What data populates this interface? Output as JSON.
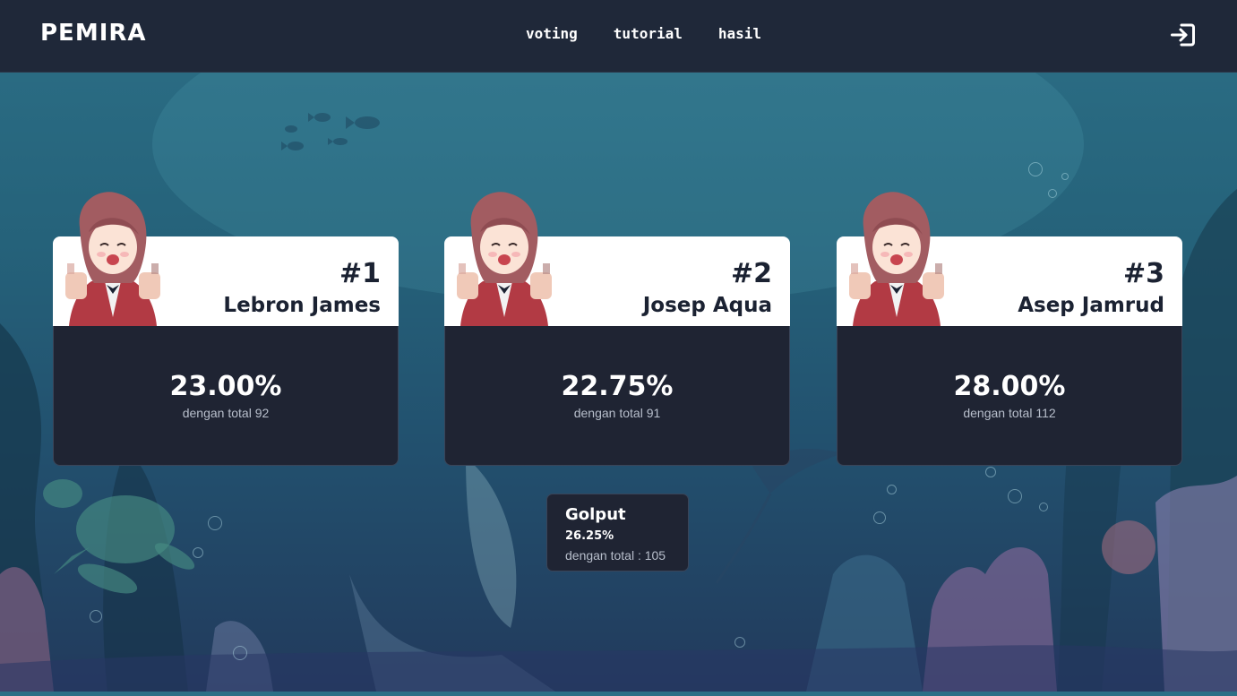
{
  "navbar": {
    "brand": "PEMIRA",
    "links": [
      "voting",
      "tutorial",
      "hasil"
    ],
    "logout_icon": "logout-icon"
  },
  "candidates": [
    {
      "number": "#1",
      "name": "Lebron James",
      "percent": "23.00%",
      "total": "dengan total 92"
    },
    {
      "number": "#2",
      "name": "Josep Aqua",
      "percent": "22.75%",
      "total": "dengan total 91"
    },
    {
      "number": "#3",
      "name": "Asep Jamrud",
      "percent": "28.00%",
      "total": "dengan total 112"
    }
  ],
  "golput": {
    "title": "Golput",
    "percent": "26.25%",
    "total": "dengan total : 105"
  },
  "colors": {
    "navbar": "#1f2839",
    "card_dark": "#1f2433",
    "card_light": "#ffffff",
    "text_dark": "#1b2232"
  }
}
